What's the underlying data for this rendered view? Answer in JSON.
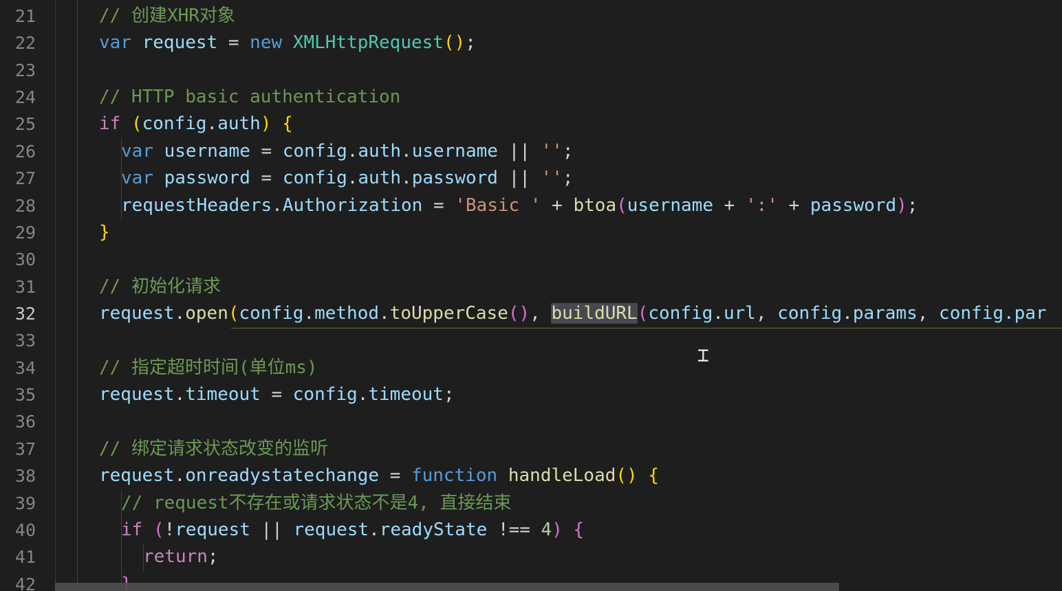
{
  "editor": {
    "line_numbers": [
      "21",
      "22",
      "23",
      "24",
      "25",
      "26",
      "27",
      "28",
      "29",
      "30",
      "31",
      "32",
      "33",
      "34",
      "35",
      "36",
      "37",
      "38",
      "39",
      "40",
      "41",
      "42"
    ],
    "active_line": "32",
    "code": {
      "l21": {
        "comment": "// 创建XHR对象"
      },
      "l22": {
        "kw_var": "var",
        "name": "request",
        "eq": " = ",
        "kw_new": "new",
        "cls": "XMLHttpRequest",
        "open": "(",
        "close": ")",
        "semi": ";"
      },
      "l24": {
        "comment": "// HTTP basic authentication"
      },
      "l25": {
        "kw_if": "if",
        "p_open": "(",
        "obj": "config",
        "dot": ".",
        "prop": "auth",
        "p_close": ")",
        "brace": "{"
      },
      "l26": {
        "kw": "var",
        "name": "username",
        "eq": " = ",
        "obj": "config",
        "p1": "auth",
        "p2": "username",
        "or": " || ",
        "str": "''",
        "semi": ";"
      },
      "l27": {
        "kw": "var",
        "name": "password",
        "eq": " = ",
        "obj": "config",
        "p1": "auth",
        "p2": "password",
        "or": " || ",
        "str": "''",
        "semi": ";"
      },
      "l28": {
        "obj": "requestHeaders",
        "prop": "Authorization",
        "eq": " = ",
        "str1": "'Basic '",
        "plus": " + ",
        "fn": "btoa",
        "open": "(",
        "a": "username",
        "str2": "':'",
        "b": "password",
        "close": ")",
        "semi": ";"
      },
      "l29": {
        "brace": "}"
      },
      "l31": {
        "comment": "// 初始化请求"
      },
      "l32": {
        "obj": "request",
        "fn_open": "open",
        "p_open": "(",
        "config": "config",
        "method": "method",
        "fn_upper": "toUpperCase",
        "call": "()",
        "comma": ", ",
        "fn_build": "buildURL",
        "p2_open": "(",
        "url": "url",
        "params": "params",
        "tail": "config.par"
      },
      "l34": {
        "comment": "// 指定超时时间(单位ms)"
      },
      "l35": {
        "obj": "request",
        "prop": "timeout",
        "eq": " = ",
        "obj2": "config",
        "prop2": "timeout",
        "semi": ";"
      },
      "l37": {
        "comment": "// 绑定请求状态改变的监听"
      },
      "l38": {
        "obj": "request",
        "prop": "onreadystatechange",
        "eq": " = ",
        "kw": "function",
        "fn": "handleLoad",
        "call": "()",
        "brace": "{"
      },
      "l39": {
        "comment": "// request不存在或请求状态不是4, 直接结束"
      },
      "l40": {
        "kw": "if",
        "p_open": "(",
        "not": "!",
        "obj": "request",
        "or": " || ",
        "obj2": "request",
        "prop": "readyState",
        "neq": " !== ",
        "num": "4",
        "p_close": ")",
        "brace": "{"
      },
      "l41": {
        "kw": "return",
        "semi": ";"
      },
      "l42": {
        "brace": "}"
      }
    },
    "colors": {
      "background": "#1e1e1e",
      "comment": "#6a9955",
      "keyword": "#569cd6",
      "control": "#c586c0",
      "variable": "#9cdcfe",
      "class": "#4ec9b0",
      "function": "#dcdcaa",
      "string": "#ce9178",
      "number": "#b5cea8"
    },
    "cursor_icon": "i-beam-cursor-icon"
  }
}
